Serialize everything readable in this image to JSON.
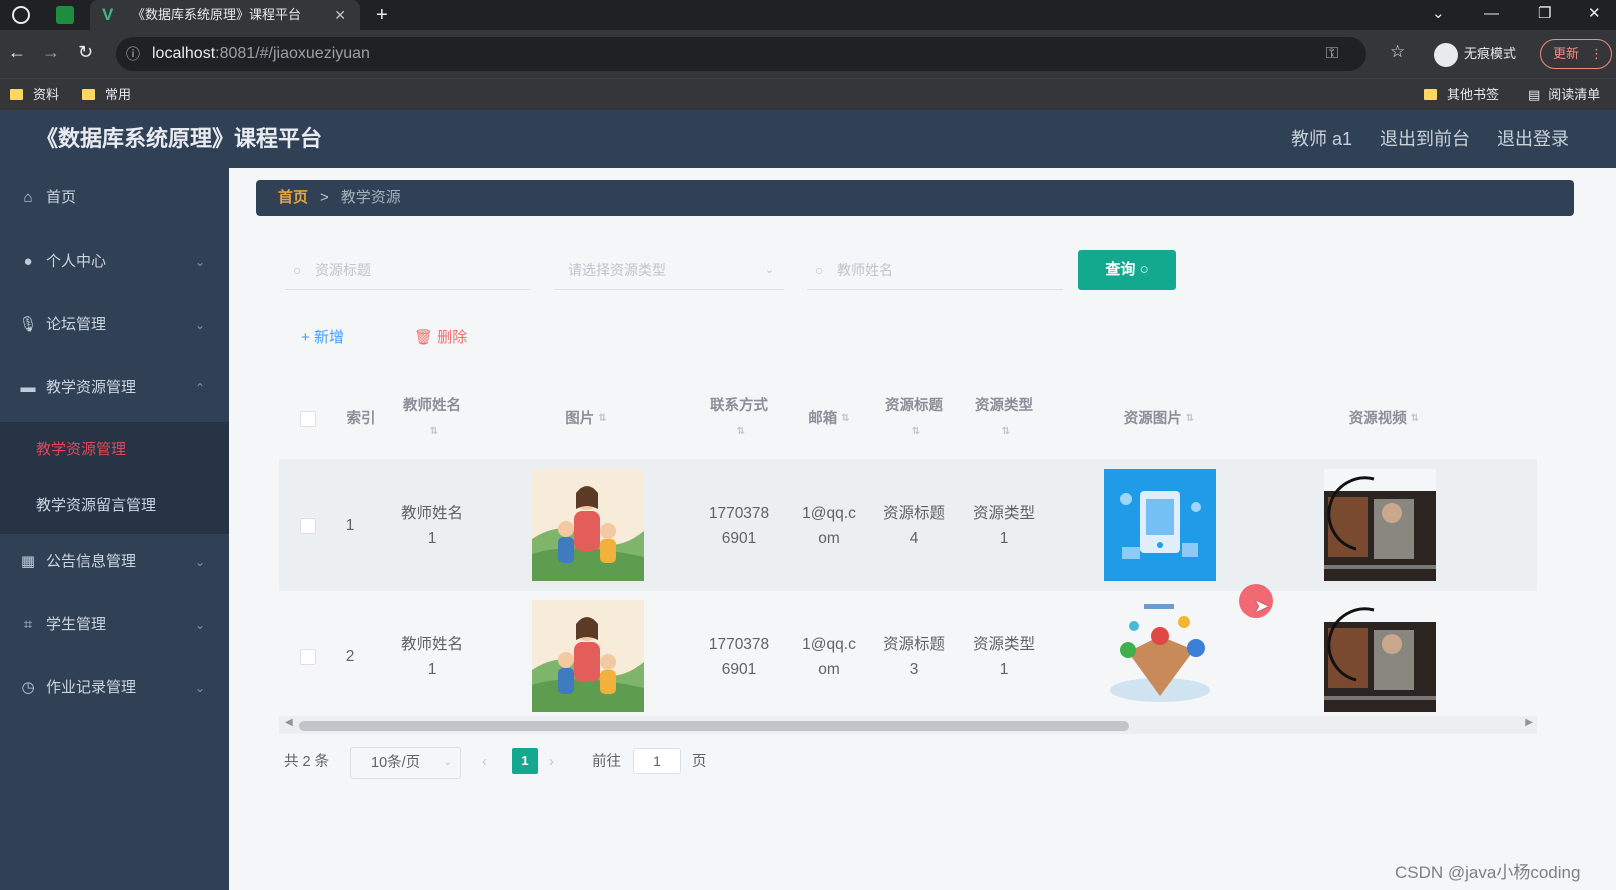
{
  "browser": {
    "tab_title": "《数据库系统原理》课程平台",
    "tab_close": "✕",
    "new_tab": "+",
    "url_host": "localhost",
    "url_path": ":8081/#/jiaoxueziyuan",
    "incognito_label": "无痕模式",
    "update_label": "更新",
    "bookmarks": [
      "资料",
      "常用"
    ],
    "other_bookmarks": "其他书签",
    "reading_list": "阅读清单"
  },
  "header": {
    "title": "《数据库系统原理》课程平台",
    "user": "教师 a1",
    "to_front": "退出到前台",
    "logout": "退出登录"
  },
  "sidebar": {
    "items": [
      {
        "label": "首页",
        "icon": "home-icon"
      },
      {
        "label": "个人中心",
        "icon": "user-icon"
      },
      {
        "label": "论坛管理",
        "icon": "mic-icon"
      },
      {
        "label": "教学资源管理",
        "icon": "briefcase-icon"
      },
      {
        "label": "公告信息管理",
        "icon": "grid-icon"
      },
      {
        "label": "学生管理",
        "icon": "crop-icon"
      },
      {
        "label": "作业记录管理",
        "icon": "clock-icon"
      }
    ],
    "subitems": [
      {
        "label": "教学资源管理",
        "active": true
      },
      {
        "label": "教学资源留言管理",
        "active": false
      }
    ],
    "active_color": "#e0475b"
  },
  "breadcrumb": {
    "home": "首页",
    "sep": ">",
    "current": "教学资源"
  },
  "search": {
    "title_placeholder": "资源标题",
    "type_placeholder": "请选择资源类型",
    "teacher_placeholder": "教师姓名",
    "query_label": "查询"
  },
  "actions": {
    "add": "新增",
    "delete": "删除"
  },
  "table": {
    "headers": {
      "index": "索引",
      "teacher_name": "教师姓名",
      "photo": "图片",
      "contact": "联系方式",
      "email": "邮箱",
      "res_title": "资源标题",
      "res_type": "资源类型",
      "res_image": "资源图片",
      "res_video": "资源视频"
    },
    "rows": [
      {
        "index": "1",
        "teacher_a": "教师姓名",
        "teacher_b": "1",
        "contact_a": "1770378",
        "contact_b": "6901",
        "email_a": "1@qq.c",
        "email_b": "om",
        "title_a": "资源标题",
        "title_b": "4",
        "type_a": "资源类型",
        "type_b": "1"
      },
      {
        "index": "2",
        "teacher_a": "教师姓名",
        "teacher_b": "1",
        "contact_a": "1770378",
        "contact_b": "6901",
        "email_a": "1@qq.c",
        "email_b": "om",
        "title_a": "资源标题",
        "title_b": "3",
        "type_a": "资源类型",
        "type_b": "1"
      }
    ]
  },
  "pagination": {
    "total": "共 2 条",
    "page_size": "10条/页",
    "current_page": "1",
    "goto_label": "前往",
    "goto_value": "1",
    "page_unit": "页"
  },
  "watermark": "CSDN @java小杨coding",
  "colors": {
    "primary": "#13a98f",
    "sidebar_bg": "#304156",
    "add": "#409eff",
    "delete": "#f56c6c"
  }
}
